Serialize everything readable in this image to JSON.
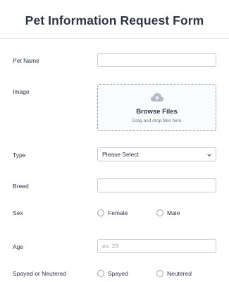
{
  "form": {
    "title": "Pet Information Request Form"
  },
  "fields": {
    "pet_name": {
      "label": "Pet Name",
      "value": ""
    },
    "image": {
      "label": "Image",
      "browse_label": "Browse Files",
      "hint": "Drag and drop files here",
      "icon": "cloud-upload-icon"
    },
    "type": {
      "label": "Type",
      "selected": "Please Select"
    },
    "breed": {
      "label": "Breed",
      "value": ""
    },
    "sex": {
      "label": "Sex",
      "options": [
        "Female",
        "Male"
      ]
    },
    "age": {
      "label": "Age",
      "placeholder": "ex: 23"
    },
    "spayed": {
      "label": "Spayed or Neutered",
      "options": [
        "Spayed",
        "Neutered"
      ]
    }
  },
  "colors": {
    "text": "#2c3345",
    "border": "#c3cad8",
    "placeholder": "#a0a8b8"
  }
}
